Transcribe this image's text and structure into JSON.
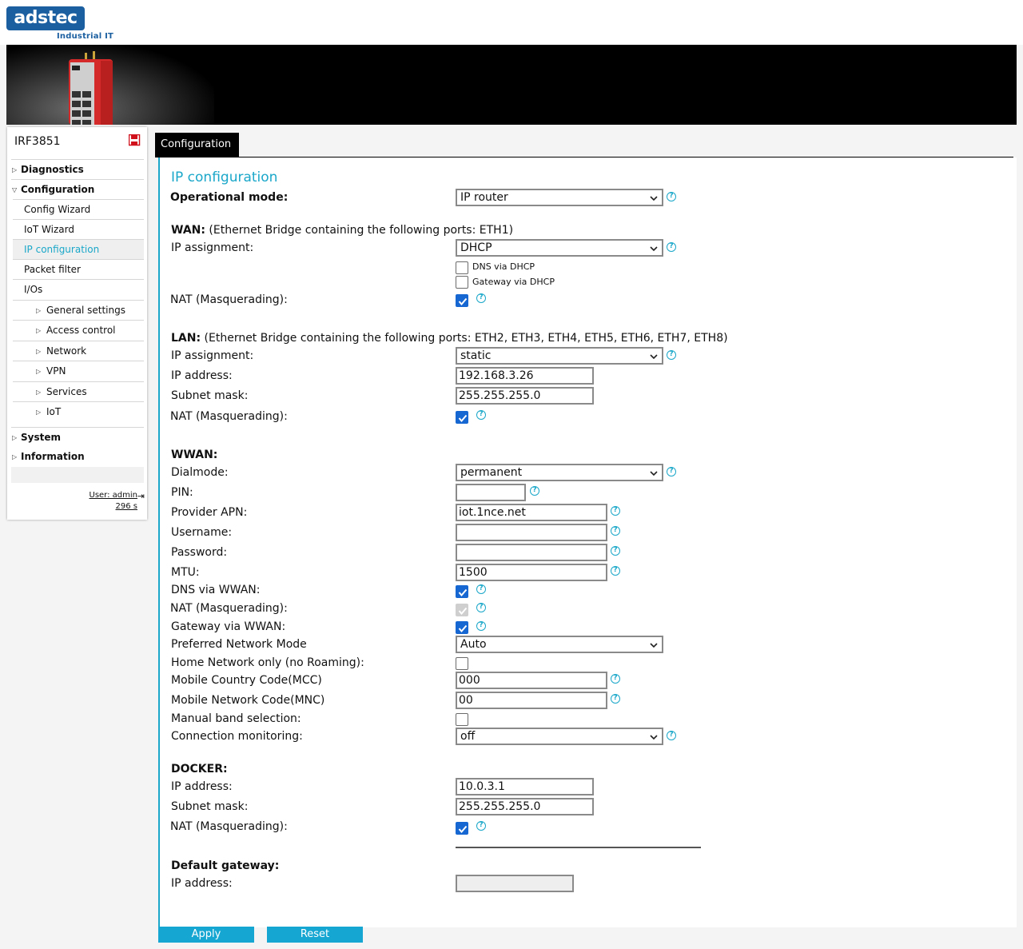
{
  "brand": {
    "logo_text": "adstec",
    "tagline": "Industrial IT"
  },
  "sidebar": {
    "device_name": "IRF3851",
    "items": [
      {
        "label": "Diagnostics"
      },
      {
        "label": "Configuration"
      },
      {
        "label": "Config Wizard"
      },
      {
        "label": "IoT Wizard"
      },
      {
        "label": "IP configuration"
      },
      {
        "label": "Packet filter"
      },
      {
        "label": "I/Os"
      },
      {
        "label": "General settings"
      },
      {
        "label": "Access control"
      },
      {
        "label": "Network"
      },
      {
        "label": "VPN"
      },
      {
        "label": "Services"
      },
      {
        "label": "IoT"
      },
      {
        "label": "System"
      },
      {
        "label": "Information"
      }
    ],
    "user_label": "User: admin",
    "timer": "296 s"
  },
  "tab": {
    "label": "Configuration"
  },
  "page": {
    "title": "IP configuration"
  },
  "operational_mode": {
    "label": "Operational mode:",
    "value": "IP router"
  },
  "wan": {
    "heading": "WAN:",
    "description": "(Ethernet Bridge containing the following ports: ETH1)",
    "ip_assignment_label": "IP assignment:",
    "ip_assignment_value": "DHCP",
    "dns_via_dhcp_label": "DNS via DHCP",
    "gateway_via_dhcp_label": "Gateway via DHCP",
    "nat_label": "NAT (Masquerading):"
  },
  "lan": {
    "heading": "LAN:",
    "description": "(Ethernet Bridge containing the following ports: ETH2, ETH3, ETH4, ETH5, ETH6, ETH7, ETH8)",
    "ip_assignment_label": "IP assignment:",
    "ip_assignment_value": "static",
    "ip_address_label": "IP address:",
    "ip_address_value": "192.168.3.26",
    "subnet_mask_label": "Subnet mask:",
    "subnet_mask_value": "255.255.255.0",
    "nat_label": "NAT (Masquerading):"
  },
  "wwan": {
    "heading": "WWAN:",
    "dialmode_label": "Dialmode:",
    "dialmode_value": "permanent",
    "pin_label": "PIN:",
    "pin_value": "",
    "apn_label": "Provider APN:",
    "apn_value": "iot.1nce.net",
    "username_label": "Username:",
    "username_value": "",
    "password_label": "Password:",
    "password_value": "",
    "mtu_label": "MTU:",
    "mtu_value": "1500",
    "dns_label": "DNS via WWAN:",
    "nat_label": "NAT (Masquerading):",
    "gateway_label": "Gateway via WWAN:",
    "network_mode_label": "Preferred Network Mode",
    "network_mode_value": "Auto",
    "home_only_label": "Home Network only (no Roaming):",
    "mcc_label": "Mobile Country Code(MCC)",
    "mcc_value": "000",
    "mnc_label": "Mobile Network Code(MNC)",
    "mnc_value": "00",
    "manual_band_label": "Manual band selection:",
    "monitoring_label": "Connection monitoring:",
    "monitoring_value": "off"
  },
  "docker": {
    "heading": "DOCKER:",
    "ip_address_label": "IP address:",
    "ip_address_value": "10.0.3.1",
    "subnet_mask_label": "Subnet mask:",
    "subnet_mask_value": "255.255.255.0",
    "nat_label": "NAT (Masquerading):"
  },
  "default_gateway": {
    "heading": "Default gateway:",
    "ip_address_label": "IP address:",
    "ip_address_value": ""
  },
  "buttons": {
    "apply": "Apply",
    "reset": "Reset"
  },
  "colors": {
    "accent": "#1aa7c9",
    "button": "#16a6d2",
    "checkbox_on": "#1767d2",
    "brand": "#1b5fa0"
  }
}
